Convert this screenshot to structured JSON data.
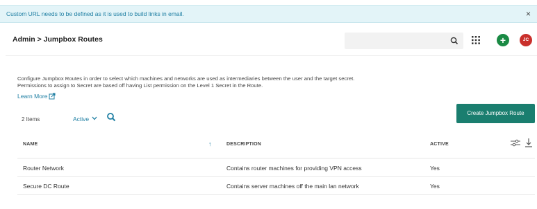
{
  "banner": {
    "message": "Custom URL needs to be defined as it is used to build links in email.",
    "close_label": "×"
  },
  "header": {
    "breadcrumb": "Admin > Jumpbox Routes",
    "search_placeholder": "",
    "avatar_initials": "JC",
    "add_label": "+"
  },
  "intro": {
    "line1": "Configure Jumpbox Routes in order to select which machines and networks are used as intermediaries between the user and the target secret.",
    "line2": "Permissions to assign to Secret are based off having List permission on the Level 1 Secret in the Route.",
    "learn_more": "Learn More"
  },
  "toolbar": {
    "items_count": "2 Items",
    "active_filter": "Active",
    "create_button": "Create Jumpbox Route"
  },
  "table": {
    "columns": [
      "NAME",
      "DESCRIPTION",
      "ACTIVE"
    ],
    "rows": [
      {
        "name": "Router Network",
        "description": "Contains router machines for providing VPN access",
        "active": "Yes"
      },
      {
        "name": "Secure DC Route",
        "description": "Contains server machines off the main lan network",
        "active": "Yes"
      }
    ]
  },
  "colors": {
    "accent": "#1f7fa3",
    "primary_button": "#1a7e6f",
    "add_button": "#1a8a44",
    "avatar": "#c9302c",
    "banner_bg": "#e3f4f8"
  }
}
